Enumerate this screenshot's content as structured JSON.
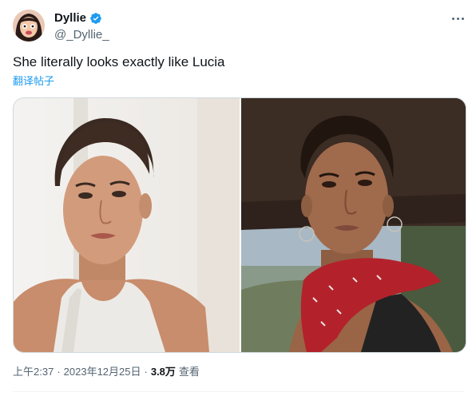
{
  "author": {
    "name": "Dyllie",
    "handle": "@_Dyllie_",
    "verified": true,
    "avatar_icon": "avatar-cartoon-face"
  },
  "tweet": {
    "text": "She literally looks exactly like Lucia",
    "translate_label": "翻译帖子"
  },
  "media": {
    "photo_left": "actress-portrait-photo",
    "photo_right": "game-character-screenshot"
  },
  "meta": {
    "time": "上午2:37",
    "separator": "·",
    "date": "2023年12月25日",
    "views_count": "3.8万",
    "views_label": "查看"
  },
  "colors": {
    "accent": "#1d9bf0",
    "muted": "#536471",
    "text": "#0f1419"
  },
  "icons": {
    "verified": "verified-badge-icon",
    "more": "more-options-icon"
  }
}
